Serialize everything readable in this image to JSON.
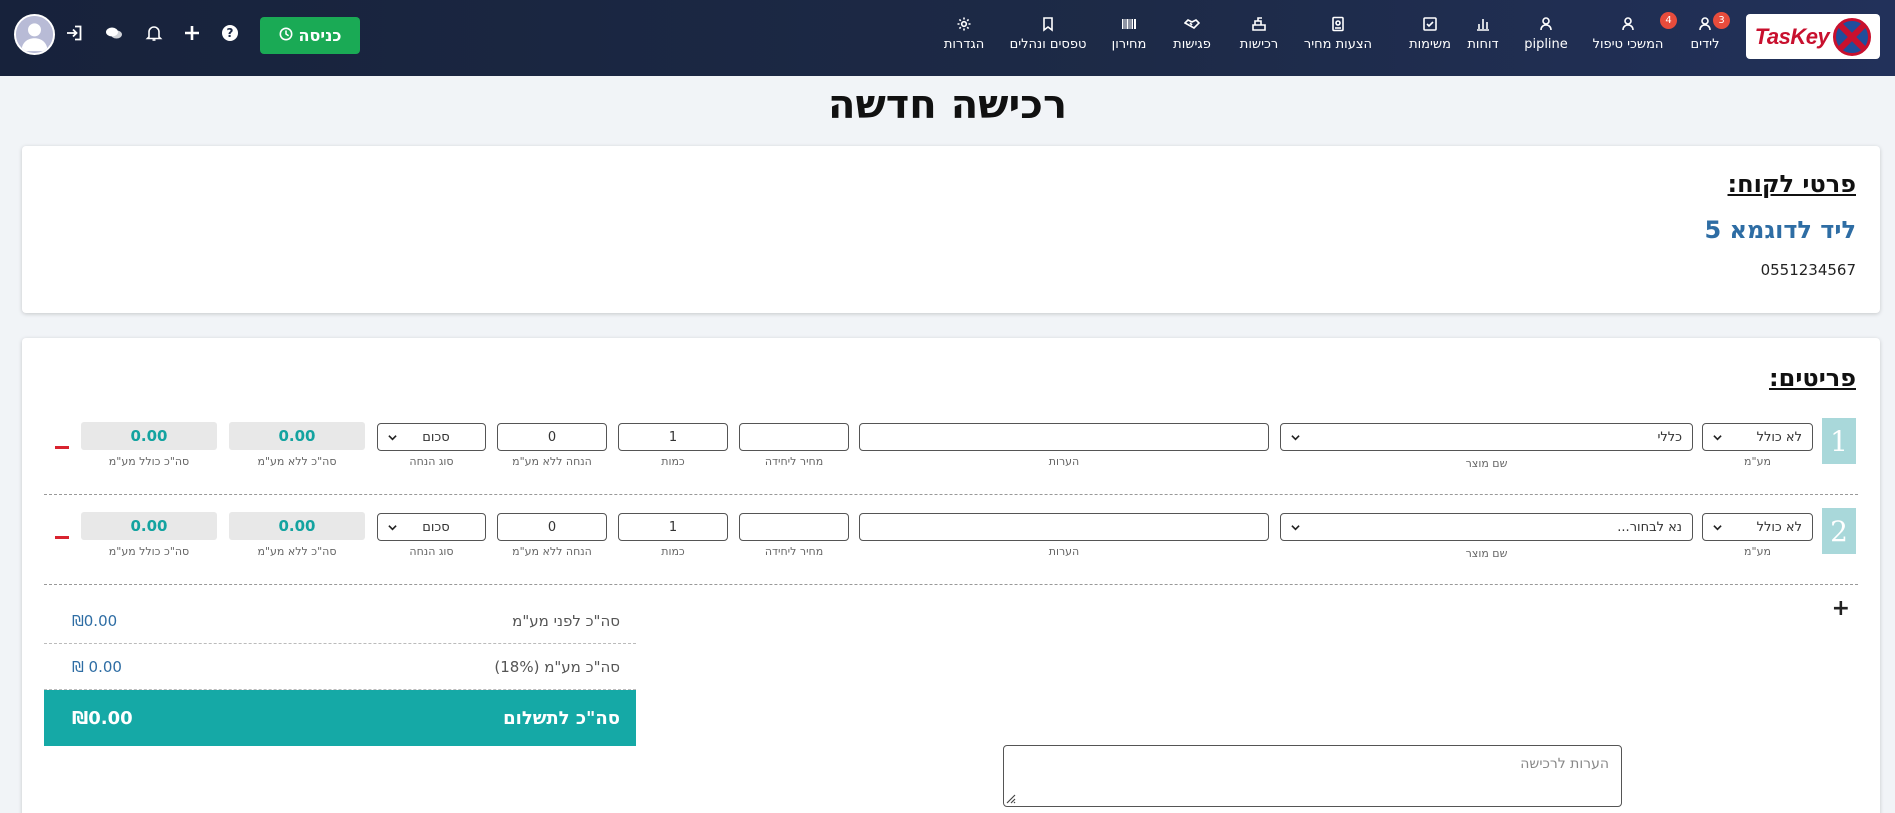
{
  "header": {
    "logo_text": "TasKey",
    "nav": [
      {
        "key": "leads",
        "label": "לידים",
        "icon": "person-icon",
        "badge": "3"
      },
      {
        "key": "continuations",
        "label": "המשכי טיפול",
        "icon": "person-icon",
        "badge": "4"
      },
      {
        "key": "pipline",
        "label": "pipline",
        "icon": "person-icon"
      },
      {
        "key": "reports",
        "label": "דוחות",
        "icon": "bar-chart-icon"
      },
      {
        "key": "tasks",
        "label": "משימות",
        "icon": "checkbox-icon"
      },
      {
        "key": "quotes",
        "label": "הצעות מחיר",
        "icon": "document-icon"
      },
      {
        "key": "purchases",
        "label": "רכישות",
        "icon": "cash-register-icon"
      },
      {
        "key": "meetings",
        "label": "פגישות",
        "icon": "handshake-icon"
      },
      {
        "key": "pricelist",
        "label": "מחירון",
        "icon": "barcode-icon"
      },
      {
        "key": "forms",
        "label": "טפסים ונהלים",
        "icon": "bookmark-icon"
      },
      {
        "key": "settings",
        "label": "הגדרות",
        "icon": "gear-icon"
      }
    ],
    "enter_button": "כניסה"
  },
  "page_title": "רכישה חדשה",
  "customer": {
    "section_title": "פרטי לקוח:",
    "name": "ליד לדוגמא 5",
    "phone": "0551234567"
  },
  "items": {
    "section_title": "פריטים:",
    "labels": {
      "vat": "מע\"מ",
      "product": "שם מוצר",
      "notes": "הערות",
      "unit_price": "מחיר ליחידה",
      "quantity": "כמות",
      "discount": "הנחה ללא מע\"מ",
      "discount_type": "סוג הנחה",
      "total_no_vat": "סה\"כ ללא מע\"מ",
      "total_with_vat": "סה\"כ כולל מע\"מ"
    },
    "rows": [
      {
        "num": "1",
        "vat": "לא כולל",
        "product": "כללי",
        "notes": "",
        "unit_price": "",
        "quantity": "1",
        "discount": "0",
        "discount_type": "סכום",
        "total_no_vat": "0.00",
        "total_with_vat": "0.00"
      },
      {
        "num": "2",
        "vat": "לא כולל",
        "product": "נא לבחור...",
        "notes": "",
        "unit_price": "",
        "quantity": "1",
        "discount": "0",
        "discount_type": "סכום",
        "total_no_vat": "0.00",
        "total_with_vat": "0.00"
      }
    ],
    "add_symbol": "+"
  },
  "summary": {
    "subtotal_label": "סה\"כ לפני מע\"מ",
    "subtotal_value": "₪0.00",
    "vat_label": "סה\"כ מע\"מ (18%)",
    "vat_value": "₪ 0.00",
    "total_label": "סה\"כ לתשלום",
    "total_value": "₪0.00"
  },
  "purchase_notes_placeholder": "הערות לרכישה",
  "colors": {
    "header_bg": "#1b2743",
    "enter_green": "#1aaa55",
    "teal": "#15a9a6",
    "link_blue": "#2e6da4",
    "badge_red": "#e74c3c"
  }
}
